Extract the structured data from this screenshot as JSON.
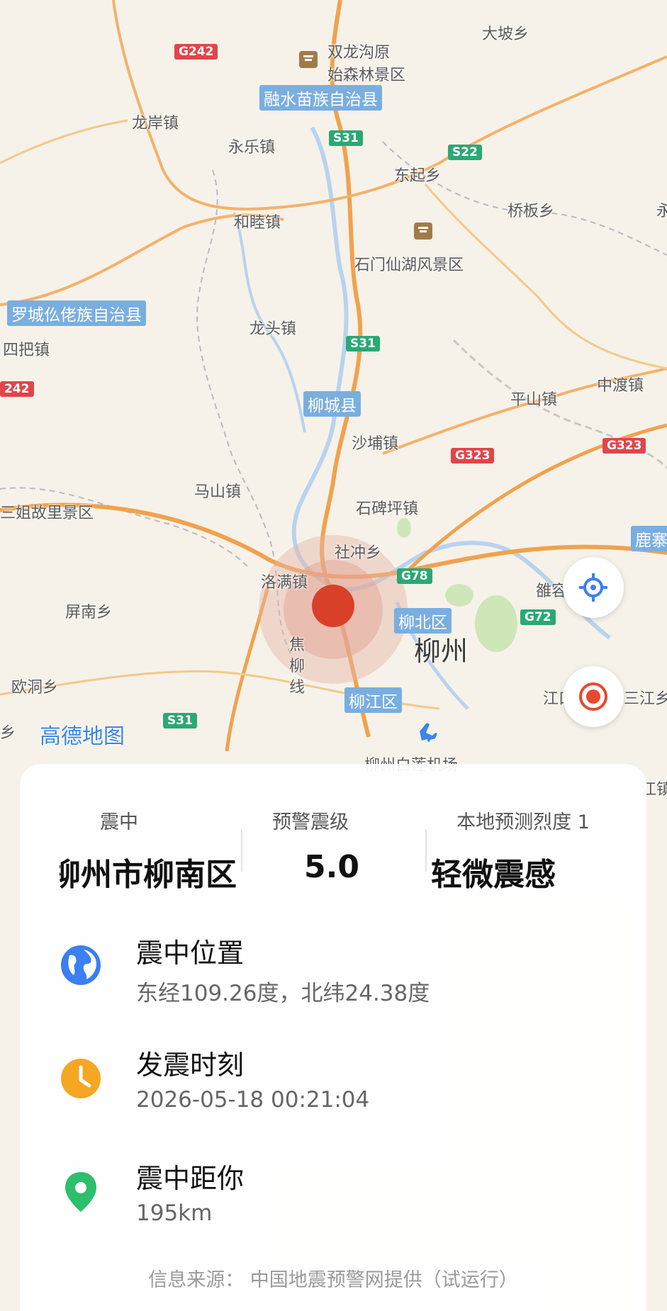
{
  "map": {
    "labels": [
      {
        "text": "大坡乡",
        "type": "town"
      },
      {
        "text": "双龙沟原",
        "type": "poi"
      },
      {
        "text": "始森林景区",
        "type": "poi"
      },
      {
        "text": "融水苗族自治县",
        "type": "county"
      },
      {
        "text": "龙岸镇",
        "type": "town"
      },
      {
        "text": "永乐镇",
        "type": "town"
      },
      {
        "text": "东起乡",
        "type": "town"
      },
      {
        "text": "桥板乡",
        "type": "town"
      },
      {
        "text": "和睦镇",
        "type": "town"
      },
      {
        "text": "石门仙湖风景区",
        "type": "poi"
      },
      {
        "text": "罗城仫佬族自治县",
        "type": "county"
      },
      {
        "text": "龙头镇",
        "type": "town"
      },
      {
        "text": "四把镇",
        "type": "town"
      },
      {
        "text": "柳城县",
        "type": "county"
      },
      {
        "text": "平山镇",
        "type": "town"
      },
      {
        "text": "中渡镇",
        "type": "town"
      },
      {
        "text": "沙埔镇",
        "type": "town"
      },
      {
        "text": "马山镇",
        "type": "town"
      },
      {
        "text": "三姐故里景区",
        "type": "poi"
      },
      {
        "text": "石碑坪镇",
        "type": "town"
      },
      {
        "text": "社冲乡",
        "type": "town"
      },
      {
        "text": "洛满镇",
        "type": "town"
      },
      {
        "text": "屏南乡",
        "type": "town"
      },
      {
        "text": "柳北区",
        "type": "county"
      },
      {
        "text": "柳州",
        "type": "city"
      },
      {
        "text": "焦柳线",
        "type": "rail"
      },
      {
        "text": "欧洞乡",
        "type": "town"
      },
      {
        "text": "柳江区",
        "type": "county"
      },
      {
        "text": "高德地图",
        "type": "brand"
      },
      {
        "text": "柳州白莲机场",
        "type": "poi"
      },
      {
        "text": "鹿寨",
        "type": "county"
      },
      {
        "text": "雒容",
        "type": "town"
      },
      {
        "text": "江口",
        "type": "town"
      },
      {
        "text": "三江乡",
        "type": "town"
      },
      {
        "text": "乡",
        "type": "town"
      },
      {
        "text": "永",
        "type": "town"
      },
      {
        "text": "江镇",
        "type": "town"
      }
    ],
    "shields": [
      {
        "text": "G242",
        "color": "g"
      },
      {
        "text": "S31",
        "color": "s"
      },
      {
        "text": "S22",
        "color": "s"
      },
      {
        "text": "S31",
        "color": "s"
      },
      {
        "text": "242",
        "color": "g"
      },
      {
        "text": "G323",
        "color": "g"
      },
      {
        "text": "G323",
        "color": "g"
      },
      {
        "text": "G78",
        "color": "s"
      },
      {
        "text": "G72",
        "color": "s"
      },
      {
        "text": "S31",
        "color": "s"
      }
    ],
    "locate_icon": "crosshair-icon",
    "epicenter_button_icon": "target-icon",
    "epicenter_color": "#d9402a"
  },
  "panel": {
    "headers": {
      "epicenter": "震中",
      "magnitude": "预警震级",
      "intensity": "本地预测烈度 1"
    },
    "values": {
      "epicenter": "柳州市柳南区",
      "magnitude": "5.0",
      "intensity": "轻微震感"
    },
    "rows": [
      {
        "icon": "globe-icon",
        "title": "震中位置",
        "value": "东经109.26度，北纬24.38度",
        "color": "#3b7ff0"
      },
      {
        "icon": "clock-icon",
        "title": "发震时刻",
        "value": "2026-05-18 00:21:04",
        "color": "#f5a623"
      },
      {
        "icon": "location-pin-icon",
        "title": "震中距你",
        "value": "195km",
        "color": "#2dbf6b"
      }
    ],
    "source": "信息来源：  中国地震预警网提供（试运行）"
  }
}
